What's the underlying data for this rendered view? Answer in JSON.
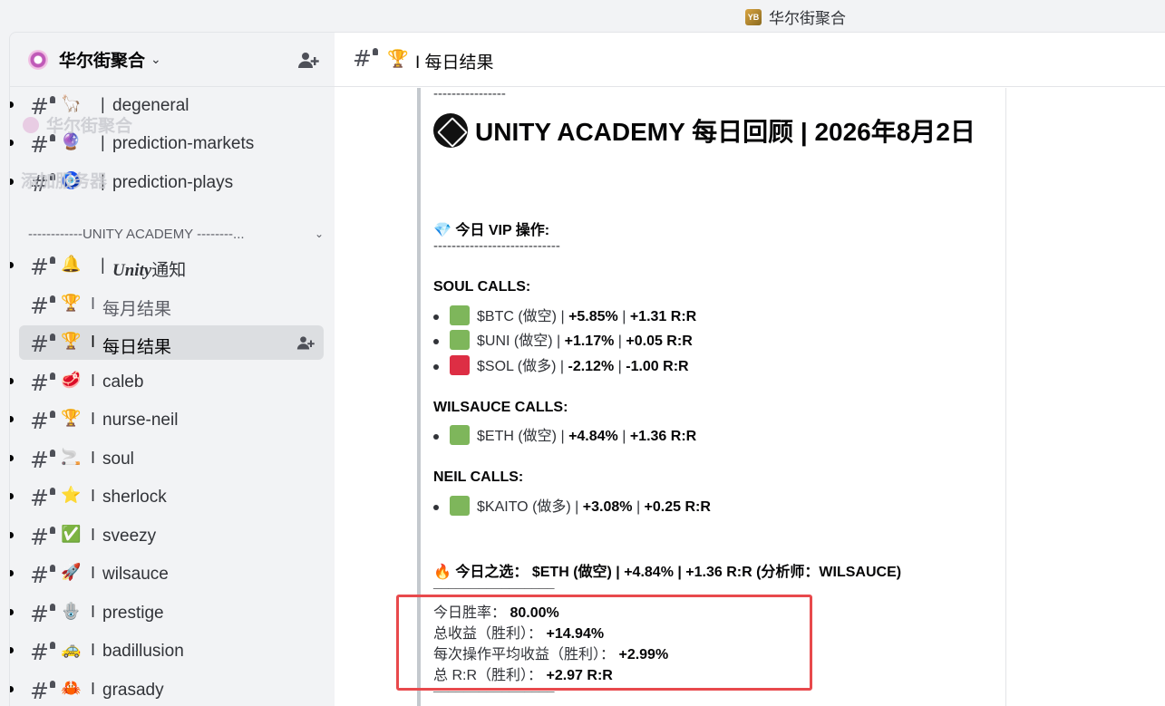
{
  "window": {
    "title": "华尔街聚合",
    "logo_text": "YB"
  },
  "server": {
    "name": "华尔街聚合",
    "ghost_name": "华尔街聚合",
    "ghost_add_server": "添加服务器"
  },
  "sidebar": {
    "channels_top": [
      {
        "emoji": "🦙",
        "sep": "|",
        "name": "degeneral"
      },
      {
        "emoji": "🔮",
        "sep": "|",
        "name": "prediction-markets"
      },
      {
        "emoji": "🧿",
        "sep": "|",
        "name": "prediction-plays"
      }
    ],
    "category": "------------UNITY ACADEMY --------...",
    "channels": [
      {
        "emoji": "🔔",
        "sep": "|",
        "name_bold": "Unity",
        "name": "通知"
      },
      {
        "emoji": "🏆",
        "sep": "I",
        "name": "每月结果"
      },
      {
        "emoji": "🏆",
        "sep": "I",
        "name": "每日结果"
      },
      {
        "emoji": "🥩",
        "sep": "I",
        "name": "caleb"
      },
      {
        "emoji": "🏆",
        "sep": "I",
        "name": "nurse-neil"
      },
      {
        "emoji": "🚬",
        "sep": "I",
        "name": "soul"
      },
      {
        "emoji": "⭐",
        "sep": "I",
        "name": "sherlock"
      },
      {
        "emoji": "✅",
        "sep": "I",
        "name": "sveezy"
      },
      {
        "emoji": "🚀",
        "sep": "I",
        "name": "wilsauce"
      },
      {
        "emoji": "🪬",
        "sep": "I",
        "name": "prestige"
      },
      {
        "emoji": "🚕",
        "sep": "I",
        "name": "badillusion"
      },
      {
        "emoji": "🦀",
        "sep": "I",
        "name": "grasady"
      }
    ]
  },
  "channel_header": {
    "emoji": "🏆",
    "title": "I 每日结果"
  },
  "message": {
    "top_dashes": "----------------",
    "title": "UNITY ACADEMY 每日回顾 | 2026年8月2日",
    "vip_emoji": "💎",
    "vip_heading": "今日 VIP 操作:",
    "vip_dashes": "----------------------------",
    "sections": [
      {
        "heading": "SOUL CALLS:",
        "calls": [
          {
            "color": "green",
            "ticker": "$BTC (做空)",
            "pct": "+5.85%",
            "rr": "+1.31 R:R"
          },
          {
            "color": "green",
            "ticker": "$UNI (做空)",
            "pct": "+1.17%",
            "rr": "+0.05 R:R"
          },
          {
            "color": "red",
            "ticker": "$SOL (做多)",
            "pct": "-2.12%",
            "rr": "-1.00 R:R"
          }
        ]
      },
      {
        "heading": "WILSAUCE CALLS:",
        "calls": [
          {
            "color": "green",
            "ticker": "$ETH (做空)",
            "pct": "+4.84%",
            "rr": "+1.36 R:R"
          }
        ]
      },
      {
        "heading": "NEIL CALLS:",
        "calls": [
          {
            "color": "green",
            "ticker": "$KAITO (做多)",
            "pct": "+3.08%",
            "rr": "+0.25 R:R"
          }
        ]
      }
    ],
    "pick_emoji": "🔥",
    "pick_label": "今日之选：",
    "pick_value": "$ETH (做空) | +4.84% | +1.36 R:R (分析师：WILSAUCE)",
    "pick_dashes": "________________",
    "stats": [
      {
        "label": "今日胜率：",
        "value": "80.00%"
      },
      {
        "label": "总收益（胜利）：",
        "value": "+14.94%"
      },
      {
        "label": "每次操作平均收益（胜利）：",
        "value": "+2.99%"
      },
      {
        "label": "总 R:R（胜利）：",
        "value": "+2.97 R:R"
      }
    ],
    "bottom_dashes": "________________"
  },
  "colors": {
    "green_square": "#7eb65b",
    "red_square": "#dd2e44",
    "highlight": "#e8494c",
    "active_channel_bg": "#dcdee1"
  }
}
